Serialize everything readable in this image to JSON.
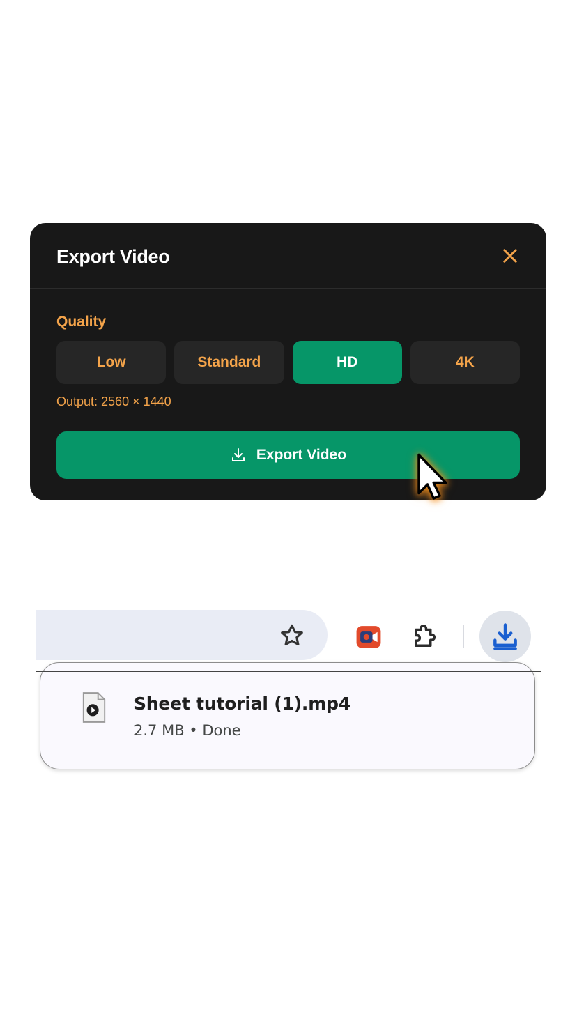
{
  "dialog": {
    "title": "Export Video",
    "quality_label": "Quality",
    "quality_options": [
      "Low",
      "Standard",
      "HD",
      "4K"
    ],
    "selected_quality": "HD",
    "output_text": "Output: 2560 × 1440",
    "export_label": "Export Video"
  },
  "download": {
    "file_name": "Sheet tutorial (1).mp4",
    "file_meta": "2.7 MB • Done"
  },
  "colors": {
    "dialog_bg": "#181818",
    "accent_green": "#069668",
    "accent_orange": "#f3a34a",
    "download_blue": "#1a5fd0"
  }
}
